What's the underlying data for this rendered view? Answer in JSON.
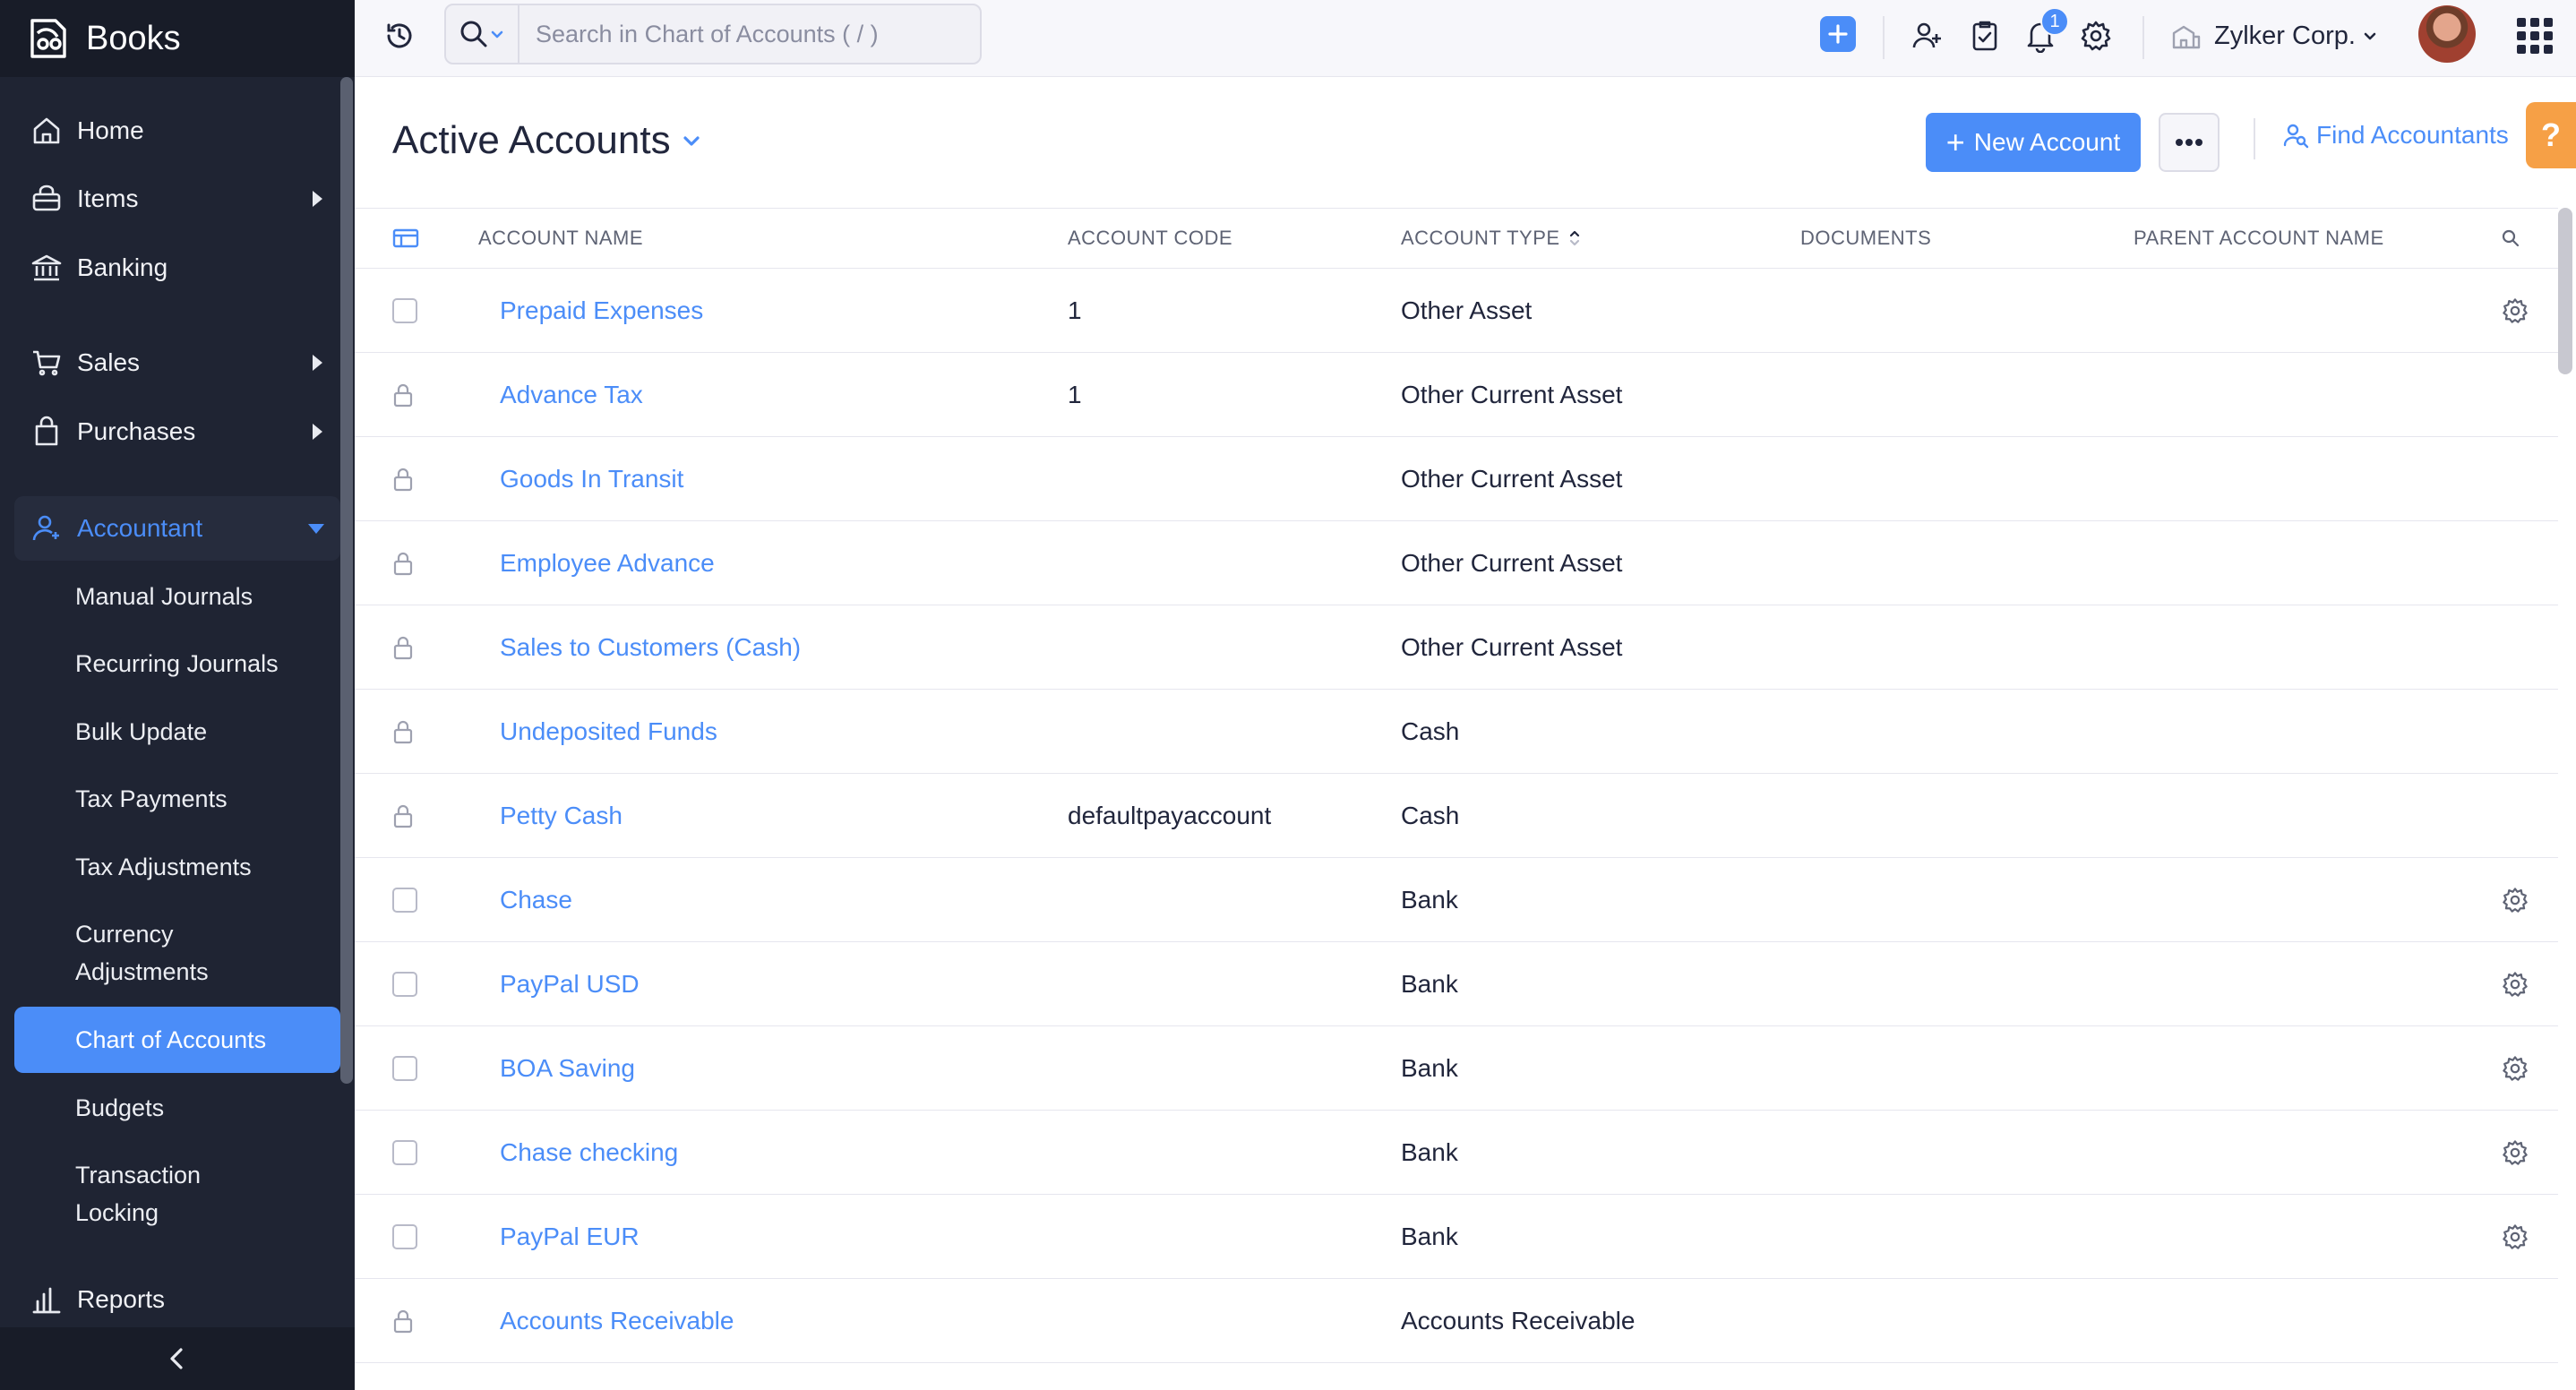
{
  "brand": {
    "name": "Books"
  },
  "sidebar": {
    "items": [
      {
        "label": "Home"
      },
      {
        "label": "Items"
      },
      {
        "label": "Banking"
      },
      {
        "label": "Sales"
      },
      {
        "label": "Purchases"
      },
      {
        "label": "Accountant"
      },
      {
        "label": "Reports"
      }
    ],
    "accountant_sub": [
      {
        "label": "Manual Journals"
      },
      {
        "label": "Recurring Journals"
      },
      {
        "label": "Bulk Update"
      },
      {
        "label": "Tax Payments"
      },
      {
        "label": "Tax Adjustments"
      },
      {
        "label": "Currency Adjustments"
      },
      {
        "label": "Chart of Accounts"
      },
      {
        "label": "Budgets"
      },
      {
        "label": "Transaction Locking"
      }
    ]
  },
  "topbar": {
    "search_placeholder": "Search in Chart of Accounts ( / )",
    "notification_count": "1",
    "org_name": "Zylker Corp."
  },
  "header": {
    "title": "Active Accounts",
    "new_account_label": "New Account",
    "find_accountants_label": "Find Accountants",
    "help_label": "?"
  },
  "table": {
    "columns": {
      "name": "ACCOUNT NAME",
      "code": "ACCOUNT CODE",
      "type": "ACCOUNT TYPE",
      "documents": "DOCUMENTS",
      "parent": "PARENT ACCOUNT NAME"
    },
    "rows": [
      {
        "name": "Prepaid Expenses",
        "code": "1",
        "type": "Other Asset",
        "locked": false,
        "gear": true
      },
      {
        "name": "Advance Tax",
        "code": "1",
        "type": "Other Current Asset",
        "locked": true,
        "gear": false
      },
      {
        "name": "Goods In Transit",
        "code": "",
        "type": "Other Current Asset",
        "locked": true,
        "gear": false
      },
      {
        "name": "Employee Advance",
        "code": "",
        "type": "Other Current Asset",
        "locked": true,
        "gear": false
      },
      {
        "name": "Sales to Customers (Cash)",
        "code": "",
        "type": "Other Current Asset",
        "locked": true,
        "gear": false
      },
      {
        "name": "Undeposited Funds",
        "code": "",
        "type": "Cash",
        "locked": true,
        "gear": false
      },
      {
        "name": "Petty Cash",
        "code": "defaultpayaccount",
        "type": "Cash",
        "locked": true,
        "gear": false
      },
      {
        "name": "Chase",
        "code": "",
        "type": "Bank",
        "locked": false,
        "gear": true
      },
      {
        "name": "PayPal USD",
        "code": "",
        "type": "Bank",
        "locked": false,
        "gear": true
      },
      {
        "name": "BOA Saving",
        "code": "",
        "type": "Bank",
        "locked": false,
        "gear": true
      },
      {
        "name": "Chase checking",
        "code": "",
        "type": "Bank",
        "locked": false,
        "gear": true
      },
      {
        "name": "PayPal EUR",
        "code": "",
        "type": "Bank",
        "locked": false,
        "gear": true
      },
      {
        "name": "Accounts Receivable",
        "code": "",
        "type": "Accounts Receivable",
        "locked": true,
        "gear": false
      }
    ]
  },
  "colors": {
    "accent": "#4b8df8",
    "sidebar_bg": "#1f2433",
    "help": "#f6a046"
  }
}
